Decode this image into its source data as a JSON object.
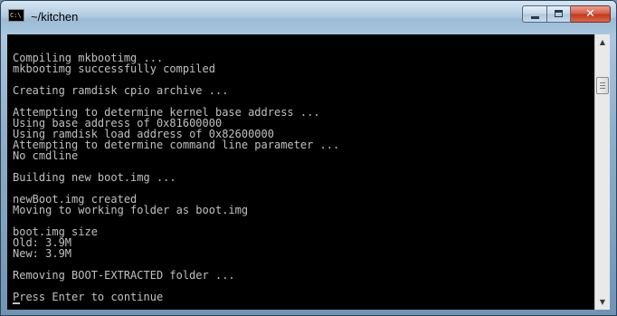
{
  "window": {
    "title": "~/kitchen",
    "icon": "console-icon",
    "icon_text": "C:\\",
    "buttons": {
      "minimize": "minimize-icon",
      "maximize": "maximize-icon",
      "close": "close-icon",
      "close_glyph": "✕"
    },
    "accent": "#9dbbd6",
    "close_color": "#c2381f"
  },
  "console": {
    "background": "#000000",
    "foreground": "#c0c0c0",
    "lines": [
      "",
      "Compiling mkbootimg ...",
      "mkbootimg successfully compiled",
      "",
      "Creating ramdisk cpio archive ...",
      "",
      "Attempting to determine kernel base address ...",
      "Using base address of 0x81600000",
      "Using ramdisk load address of 0x82600000",
      "Attempting to determine command line parameter ...",
      "No cmdline",
      "",
      "Building new boot.img ...",
      "",
      "newBoot.img created",
      "Moving to working folder as boot.img",
      "",
      "boot.img size",
      "Old: 3.9M",
      "New: 3.9M",
      "",
      "Removing BOOT-EXTRACTED folder ...",
      "",
      "Press Enter to continue"
    ]
  },
  "scrollbar": {
    "up_arrow": "▲",
    "down_arrow": "▼",
    "position_fraction": 0.12
  }
}
